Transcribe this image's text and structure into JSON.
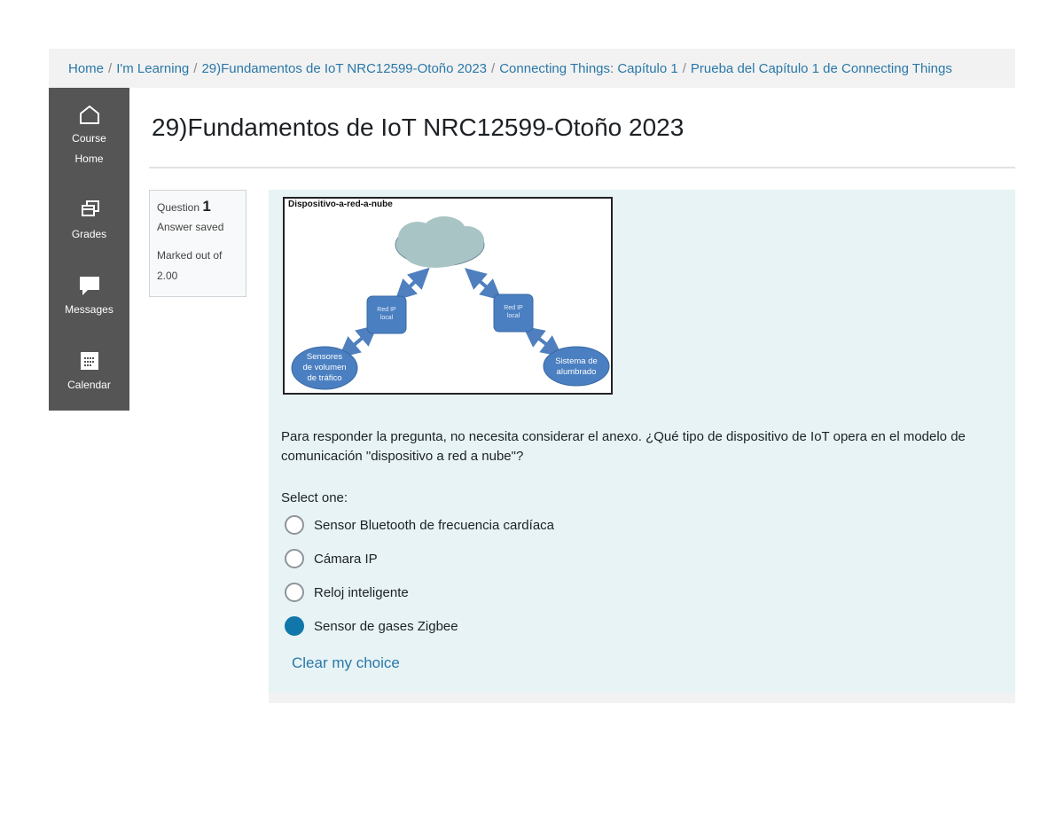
{
  "breadcrumb": {
    "items": [
      "Home",
      "I'm Learning",
      "29)Fundamentos de IoT NRC12599-Otoño 2023",
      "Connecting Things: Capítulo 1",
      "Prueba del Capítulo 1 de Connecting Things"
    ],
    "separator": "/"
  },
  "sidebar": {
    "items": [
      {
        "line1": "Course",
        "line2": "Home",
        "icon": "home-icon"
      },
      {
        "line1": "Grades",
        "icon": "grades-icon"
      },
      {
        "line1": "Messages",
        "icon": "messages-icon"
      },
      {
        "line1": "Calendar",
        "icon": "calendar-icon"
      }
    ]
  },
  "page": {
    "title": "29)Fundamentos de IoT NRC12599-Otoño 2023"
  },
  "question": {
    "label": "Question",
    "number": "1",
    "status": "Answer saved",
    "marked_line1": "Marked out of",
    "marked_line2": "2.00",
    "diagram": {
      "title": "Dispositivo-a-red-a-nube",
      "left_net_line1": "Red IP",
      "left_net_line2": "local",
      "right_net_line1": "Red IP",
      "right_net_line2": "local",
      "left_device_line1": "Sensores",
      "left_device_line2": "de volumen",
      "left_device_line3": "de tráfico",
      "right_device_line1": "Sistema de",
      "right_device_line2": "alumbrado"
    },
    "text": "Para responder la pregunta, no necesita considerar el anexo. ¿Qué tipo de dispositivo de IoT opera en el modelo de comunicación \"dispositivo a red a nube\"?",
    "select_label": "Select one:",
    "options": [
      {
        "label": "Sensor Bluetooth de frecuencia cardíaca",
        "checked": false
      },
      {
        "label": "Cámara IP",
        "checked": false
      },
      {
        "label": "Reloj inteligente",
        "checked": false
      },
      {
        "label": "Sensor de gases Zigbee",
        "checked": true
      }
    ],
    "clear_label": "Clear my choice"
  },
  "colors": {
    "accent": "#1177aa",
    "link": "#2a78a8",
    "sidebar_bg": "#555555",
    "question_bg": "#e7f3f5"
  }
}
